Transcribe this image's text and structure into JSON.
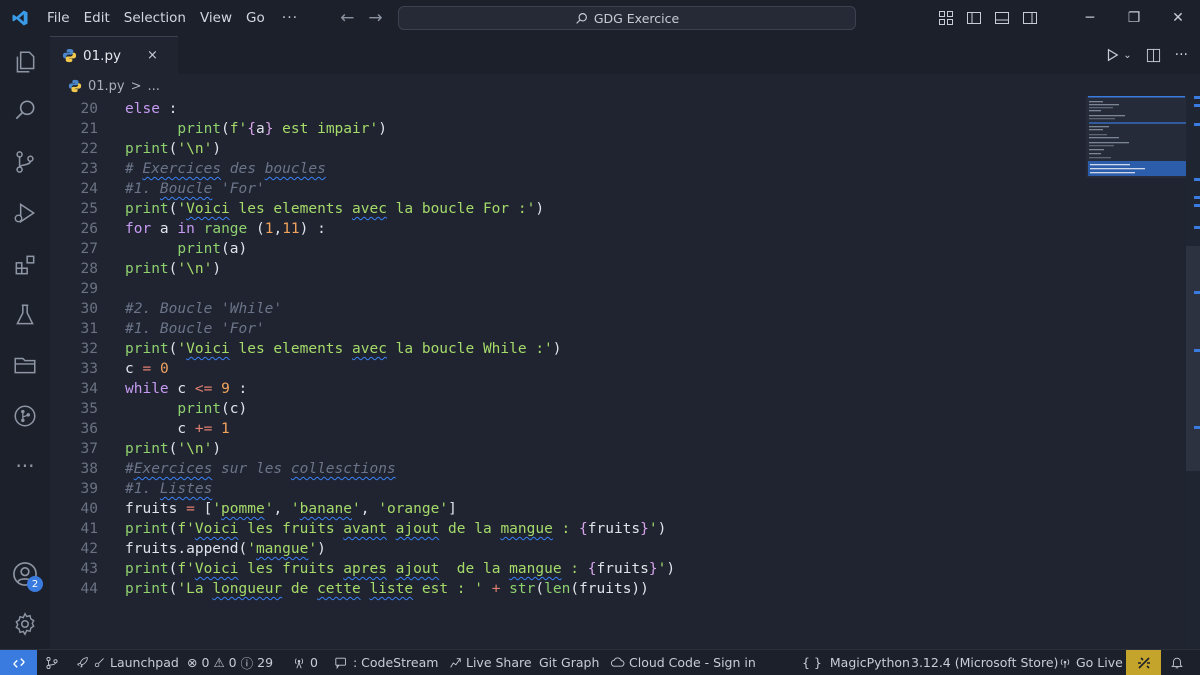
{
  "menu": [
    "File",
    "Edit",
    "Selection",
    "View",
    "Go"
  ],
  "menu_more": "···",
  "search_title": "GDG Exercice",
  "tab": {
    "label": "01.py",
    "close": "×"
  },
  "breadcrumb": {
    "file": "01.py",
    "sep": ">",
    "rest": "..."
  },
  "activity_badge": "2",
  "colors": {
    "accent": "#3a7be0",
    "warning_badge": "#c5a42b",
    "background": "#1f2430"
  },
  "lines": [
    {
      "n": "20",
      "t": [
        [
          "kw",
          "else"
        ],
        [
          "var",
          " :"
        ]
      ]
    },
    {
      "n": "21",
      "t": [
        [
          "var",
          "      "
        ],
        [
          "fn",
          "print"
        ],
        [
          "var",
          "("
        ],
        [
          "str",
          "f'"
        ],
        [
          "brace",
          "{"
        ],
        [
          "var",
          "a"
        ],
        [
          "brace",
          "}"
        ],
        [
          "str",
          " est impair'"
        ],
        [
          "var",
          ")"
        ]
      ]
    },
    {
      "n": "22",
      "t": [
        [
          "fn",
          "print"
        ],
        [
          "var",
          "("
        ],
        [
          "str",
          "'\\n'"
        ],
        [
          "var",
          ")"
        ]
      ]
    },
    {
      "n": "23",
      "t": [
        [
          "com",
          "# "
        ],
        [
          "com squig",
          "Exercices"
        ],
        [
          "com",
          " des "
        ],
        [
          "com squig",
          "boucles"
        ]
      ]
    },
    {
      "n": "24",
      "t": [
        [
          "com",
          "#1. "
        ],
        [
          "com squig",
          "Boucle"
        ],
        [
          "com",
          " 'For'"
        ]
      ]
    },
    {
      "n": "25",
      "t": [
        [
          "fn",
          "print"
        ],
        [
          "var",
          "("
        ],
        [
          "str",
          "'"
        ],
        [
          "str squig",
          "Voici"
        ],
        [
          "str",
          " les elements "
        ],
        [
          "str squig",
          "avec"
        ],
        [
          "str",
          " la boucle For :'"
        ],
        [
          "var",
          ")"
        ]
      ]
    },
    {
      "n": "26",
      "t": [
        [
          "kw",
          "for"
        ],
        [
          "var",
          " a "
        ],
        [
          "kw",
          "in"
        ],
        [
          "var",
          " "
        ],
        [
          "fn",
          "range"
        ],
        [
          "var",
          " ("
        ],
        [
          "num",
          "1"
        ],
        [
          "var",
          ","
        ],
        [
          "num",
          "11"
        ],
        [
          "var",
          ") :"
        ]
      ]
    },
    {
      "n": "27",
      "t": [
        [
          "var",
          "      "
        ],
        [
          "fn",
          "print"
        ],
        [
          "var",
          "(a)"
        ]
      ]
    },
    {
      "n": "28",
      "t": [
        [
          "fn",
          "print"
        ],
        [
          "var",
          "("
        ],
        [
          "str",
          "'\\n'"
        ],
        [
          "var",
          ")"
        ]
      ]
    },
    {
      "n": "29",
      "t": []
    },
    {
      "n": "30",
      "t": [
        [
          "com",
          "#2. Boucle 'While'"
        ]
      ]
    },
    {
      "n": "31",
      "t": [
        [
          "com",
          "#1. Boucle 'For'"
        ]
      ]
    },
    {
      "n": "32",
      "t": [
        [
          "fn",
          "print"
        ],
        [
          "var",
          "("
        ],
        [
          "str",
          "'"
        ],
        [
          "str squig",
          "Voici"
        ],
        [
          "str",
          " les elements "
        ],
        [
          "str squig",
          "avec"
        ],
        [
          "str",
          " la boucle While :'"
        ],
        [
          "var",
          ")"
        ]
      ]
    },
    {
      "n": "33",
      "t": [
        [
          "var",
          "c "
        ],
        [
          "op",
          "="
        ],
        [
          "var",
          " "
        ],
        [
          "num",
          "0"
        ]
      ]
    },
    {
      "n": "34",
      "t": [
        [
          "kw",
          "while"
        ],
        [
          "var",
          " c "
        ],
        [
          "op",
          "<="
        ],
        [
          "var",
          " "
        ],
        [
          "num",
          "9"
        ],
        [
          "var",
          " :"
        ]
      ]
    },
    {
      "n": "35",
      "t": [
        [
          "var",
          "      "
        ],
        [
          "fn",
          "print"
        ],
        [
          "var",
          "(c)"
        ]
      ]
    },
    {
      "n": "36",
      "t": [
        [
          "var",
          "      c "
        ],
        [
          "op",
          "+="
        ],
        [
          "var",
          " "
        ],
        [
          "num",
          "1"
        ]
      ]
    },
    {
      "n": "37",
      "t": [
        [
          "fn",
          "print"
        ],
        [
          "var",
          "("
        ],
        [
          "str",
          "'\\n'"
        ],
        [
          "var",
          ")"
        ]
      ]
    },
    {
      "n": "38",
      "t": [
        [
          "com",
          "#"
        ],
        [
          "com squig",
          "Exercices"
        ],
        [
          "com",
          " sur les "
        ],
        [
          "com squig",
          "collesctions"
        ]
      ]
    },
    {
      "n": "39",
      "t": [
        [
          "com",
          "#1. "
        ],
        [
          "com squig",
          "Listes"
        ]
      ]
    },
    {
      "n": "40",
      "t": [
        [
          "var",
          "fruits "
        ],
        [
          "op",
          "="
        ],
        [
          "var",
          " ["
        ],
        [
          "str",
          "'"
        ],
        [
          "str squig",
          "pomme"
        ],
        [
          "str",
          "'"
        ],
        [
          "var",
          ", "
        ],
        [
          "str",
          "'"
        ],
        [
          "str squig",
          "banane"
        ],
        [
          "str",
          "'"
        ],
        [
          "var",
          ", "
        ],
        [
          "str",
          "'orange'"
        ],
        [
          "var",
          "]"
        ]
      ]
    },
    {
      "n": "41",
      "t": [
        [
          "fn",
          "print"
        ],
        [
          "var",
          "("
        ],
        [
          "str",
          "f'"
        ],
        [
          "str squig",
          "Voici"
        ],
        [
          "str",
          " les fruits "
        ],
        [
          "str squig",
          "avant"
        ],
        [
          "str",
          " "
        ],
        [
          "str squig",
          "ajout"
        ],
        [
          "str",
          " de la "
        ],
        [
          "str squig",
          "mangue"
        ],
        [
          "str",
          " : "
        ],
        [
          "brace",
          "{"
        ],
        [
          "var",
          "fruits"
        ],
        [
          "brace",
          "}"
        ],
        [
          "str",
          "'"
        ],
        [
          "var",
          ")"
        ]
      ]
    },
    {
      "n": "42",
      "t": [
        [
          "var",
          "fruits.append("
        ],
        [
          "str",
          "'"
        ],
        [
          "str squig",
          "mangue"
        ],
        [
          "str",
          "'"
        ],
        [
          "var",
          ")"
        ]
      ]
    },
    {
      "n": "43",
      "t": [
        [
          "fn",
          "print"
        ],
        [
          "var",
          "("
        ],
        [
          "str",
          "f'"
        ],
        [
          "str squig",
          "Voici"
        ],
        [
          "str",
          " les fruits "
        ],
        [
          "str squig",
          "apres"
        ],
        [
          "str",
          " "
        ],
        [
          "str squig",
          "ajout"
        ],
        [
          "str",
          "  de la "
        ],
        [
          "str squig",
          "mangue"
        ],
        [
          "str",
          " : "
        ],
        [
          "brace",
          "{"
        ],
        [
          "var",
          "fruits"
        ],
        [
          "brace",
          "}"
        ],
        [
          "str",
          "'"
        ],
        [
          "var",
          ")"
        ]
      ]
    },
    {
      "n": "44",
      "t": [
        [
          "fn",
          "print"
        ],
        [
          "var",
          "("
        ],
        [
          "str",
          "'La "
        ],
        [
          "str squig",
          "longueur"
        ],
        [
          "str",
          " de "
        ],
        [
          "str squig",
          "cette"
        ],
        [
          "str",
          " "
        ],
        [
          "str squig",
          "liste"
        ],
        [
          "str",
          " est : '"
        ],
        [
          "var",
          " "
        ],
        [
          "op",
          "+"
        ],
        [
          "var",
          " "
        ],
        [
          "fn",
          "str"
        ],
        [
          "var",
          "("
        ],
        [
          "fn",
          "len"
        ],
        [
          "var",
          "(fruits))"
        ]
      ]
    }
  ],
  "status": {
    "launchpad": "Launchpad",
    "errors": "0",
    "warnings": "0",
    "infos": "29",
    "ports": "0",
    "codestream": ": CodeStream",
    "liveshare": "Live Share",
    "gitgraph": "Git Graph",
    "cloudcode": "Cloud Code - Sign in",
    "language": "MagicPython",
    "interpreter": "3.12.4 (Microsoft Store)",
    "golive": "Go Live"
  }
}
